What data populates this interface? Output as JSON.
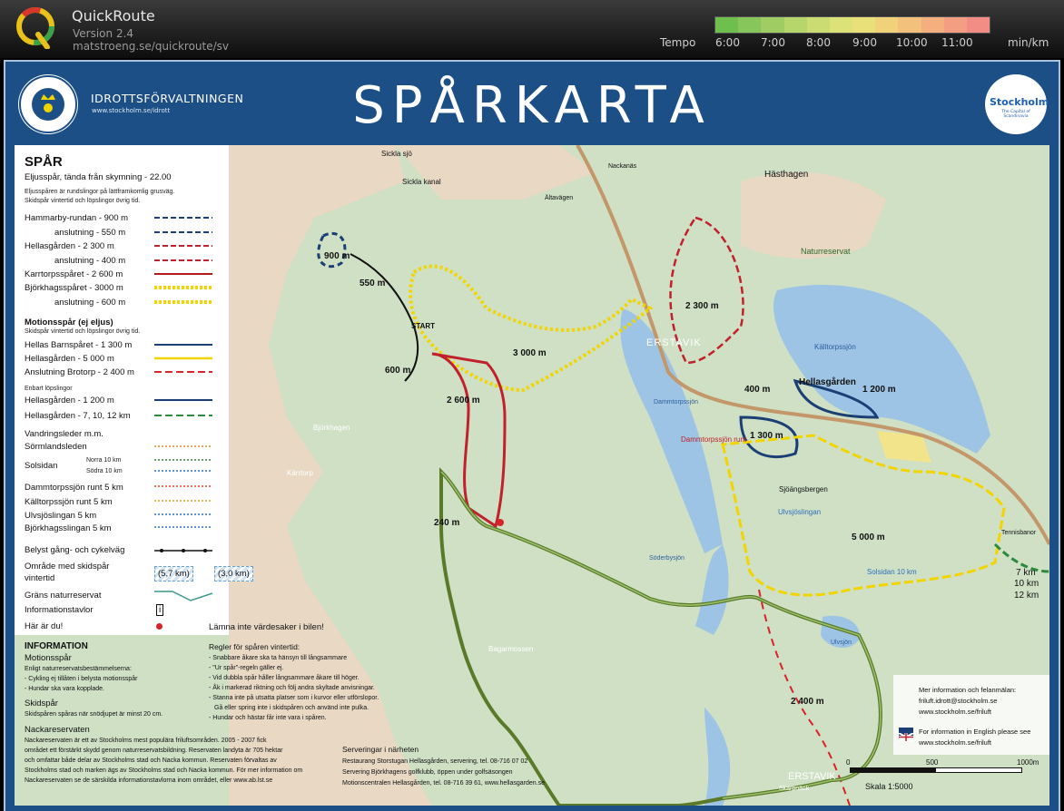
{
  "app": {
    "name": "QuickRoute",
    "version": "Version 2.4",
    "url": "matstroeng.se/quickroute/sv",
    "tempo_label": "Tempo",
    "tempo_ticks": [
      "6:00",
      "7:00",
      "8:00",
      "9:00",
      "10:00",
      "11:00"
    ],
    "tempo_unit": "min/km",
    "tempo_colors": [
      "#6fbf4f",
      "#86c65a",
      "#9fcd63",
      "#b6d56b",
      "#cbdc72",
      "#dde278",
      "#eae07a",
      "#f0d27a",
      "#f2c27c",
      "#f3b07e",
      "#f39e82",
      "#f28d86"
    ]
  },
  "header": {
    "org_name": "IDROTTSFÖRVALTNINGEN",
    "org_url": "www.stockholm.se/idrott",
    "title": "SPÅRKARTA",
    "badge": "Stockholm",
    "badge_sub": "The Capital of Scandinavia",
    "seal_text": "STOCKHOLMS STAD"
  },
  "legend": {
    "heading": "SPÅR",
    "eljus_title": "Eljusspår, tända från skymning - 22.00",
    "eljus_note1": "Eljusspåren är rundslingor på lättframkomlig grusväg.",
    "eljus_note2": "Skidspår vintertid och löpslingor övrig tid.",
    "items_eljus": [
      {
        "label": "Hammarby-rundan - 900 m",
        "color": "#1b3f75"
      },
      {
        "label": "anslutning - 550 m",
        "color": "#1b3f75"
      },
      {
        "label": "Hellasgården - 2 300 m",
        "color": "#c0212c"
      },
      {
        "label": "anslutning - 400 m",
        "color": "#c0212c"
      },
      {
        "label": "Karrtorpsspåret - 2 600 m",
        "color": "#b31c1c"
      },
      {
        "label": "Björkhagsspåret - 3000 m",
        "color": "#f2d500"
      },
      {
        "label": "anslutning - 600 m",
        "color": "#f2d500"
      }
    ],
    "motion_title": "Motionsspår (ej eljus)",
    "motion_note": "Skidspår vintertid och löpslingor övrig tid.",
    "items_motion": [
      {
        "label": "Hellas Barnspåret - 1 300 m",
        "color": "#1b3f75"
      },
      {
        "label": "Hellasgården - 5 000 m",
        "color": "#f2d500"
      },
      {
        "label": "Anslutning Brotorp - 2 400 m",
        "color": "#d8232a"
      }
    ],
    "enbart_title": "Enbart löpslingor",
    "items_enbart": [
      {
        "label": "Hellasgården - 1 200 m",
        "color": "#1b3f75"
      },
      {
        "label": "Hellasgården - 7, 10, 12 km",
        "color": "#2b8a3e"
      }
    ],
    "vandring_title": "Vandringsleder m.m.",
    "items_vandring": [
      {
        "label": "Sörmlandsleden",
        "color": "#e08a2f"
      },
      {
        "label": "Solsidan",
        "color": "#3a7d3a"
      },
      {
        "label": "Norra 10 km",
        "color": "#3a7d3a"
      },
      {
        "label": "Södra 10 km",
        "color": "#2f6fbf"
      },
      {
        "label": "Dammtorpssjön runt 5 km",
        "color": "#e0402a"
      },
      {
        "label": "Källtorpssjön runt 5 km",
        "color": "#e0a12a"
      },
      {
        "label": "Ulvsjöslingan 5 km",
        "color": "#2f6fbf"
      },
      {
        "label": "Björkhagsslingan 5 km",
        "color": "#2f6fbf"
      }
    ],
    "cykel": "Belyst gång- och cykelväg",
    "skidspar_area1": "Område med skidspår",
    "skidspar_area2": "vintertid",
    "skidspar_box1": "(5,7 km)",
    "skidspar_box2": "(3,0 km)",
    "grans": "Gräns naturreservat",
    "infotavlor": "Informationstavlor",
    "har_ar_du": "Här är du!"
  },
  "info": {
    "heading": "INFORMATION",
    "motion_h": "Motionsspår",
    "motion_1": "Enligt naturreservatsbestämmelserna:",
    "motion_2": "- Cykling ej tillåten i belysta motionsspår",
    "motion_3": "- Hundar ska vara kopplade.",
    "skid_h": "Skidspår",
    "skid_1": "Skidspåren spåras när snödjupet är minst 20 cm.",
    "nacka_h": "Nackareservaten",
    "nacka_1": "Nackareservaten är ett av Stockholms mest populära friluftsområden. 2005 - 2007 fick",
    "nacka_2": "området ett förstärkt skydd genom naturreservatsbildning. Reservaten landyta är 705 hektar",
    "nacka_3": "och omfattar både delar av Stockholms stad och Nacka kommun. Reservaten förvaltas av",
    "nacka_4": "Stockholms stad och marken ägs av Stockholms stad och Nacka kommun. För mer information om",
    "nacka_5": "Nackareservaten se de särskilda informationstavlorna inom området, eller www.ab.lst.se",
    "warning": "Lämna inte värdesaker i bilen!",
    "rules_h": "Regler för spåren vintertid:",
    "rules": [
      "- Snabbare åkare ska ta hänsyn till långsammare",
      "- \"Ur spår\"-regeln gäller ej.",
      "- Vid dubbla spår håller långsammare åkare till höger.",
      "- Åk i markerad riktning och följ andra skyltade anvisningar.",
      "- Stanna inte på utsatta platser som i kurvor eller utförslopor.",
      "  Gå eller spring inte i skidspåren och använd inte pulka.",
      "- Hundar och hästar får inte vara i spåren."
    ],
    "serv_h": "Serveringar i närheten",
    "serv": [
      "Restaurang Storstugan Hellasgården, servering, tel. 08-716 07 02",
      "Servering Björkhagens golfklubb, öppen under golfsäsongen",
      "Motionscentralen Hellasgården, tel. 08-716 39 61, www.hellasgarden.se"
    ]
  },
  "contact": {
    "line1": "Mer information och felanmälan:",
    "line2": "friluft.idrott@stockholm.se",
    "line3": "www.stockholm.se/friluft",
    "line4": "For information in English please see",
    "line5": "www.stockholm.se/friluft"
  },
  "scale": {
    "s0": "0",
    "s500": "500",
    "s1000": "1000m",
    "label": "Skala 1:5000"
  },
  "map_labels": [
    "Sickla sjö",
    "Sickla kanal",
    "Hästhagen",
    "Naturreservat",
    "Nackanäs",
    "Ältavägen",
    "900 m",
    "550 m",
    "START",
    "600 m",
    "2 300 m",
    "3 000 m",
    "2 600 m",
    "ERSTAVIK",
    "400 m",
    "Hellasgården",
    "1 200 m",
    "1 300 m",
    "Källtorpssjön",
    "Dammtorpssjön",
    "Söderbysjön",
    "5 000 m",
    "240 m",
    "2 400 m",
    "Ulvsjön",
    "7 km",
    "10 km",
    "12 km",
    "Solsidan 10 km",
    "Bagarmossen",
    "Kärrtorp",
    "Björkhagen",
    "Dammtorpssjön runt",
    "Ulvsjöslingan",
    "Sjöängsbergen",
    "Tennisbanor",
    "Skarpnäck",
    "ERSTAVIK"
  ]
}
